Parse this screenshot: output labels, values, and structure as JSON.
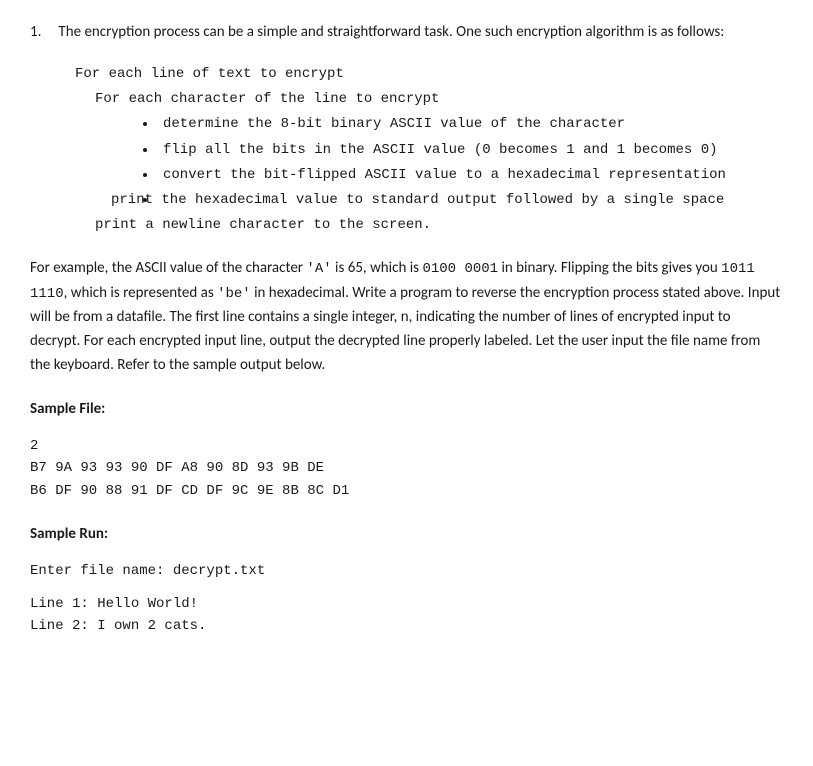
{
  "problem_number": "1.",
  "intro": "The encryption process can be a simple and straightforward task. One such encryption algorithm is as follows:",
  "algo": {
    "line1": "For each line of text to encrypt",
    "line2": "For each character of the line to encrypt",
    "bullets": [
      "determine the 8-bit binary ASCII value of the character",
      "flip all the bits in the ASCII value (0 becomes 1 and 1 becomes 0)",
      "convert the bit-flipped ASCII value to a hexadecimal representation",
      "print the hexadecimal value to standard output followed by a single space"
    ],
    "line_last": "print a newline character to the screen."
  },
  "body_p1_a": "For example, the ASCII value of the character ",
  "body_p1_code1": "'A'",
  "body_p1_b": " is 65, which is ",
  "body_p1_code2": "0100  0001",
  "body_p1_c": " in binary. Flipping the bits gives you ",
  "body_p1_code3": "1011  1110",
  "body_p1_d": ", which is represented as ",
  "body_p1_code4": "'be'",
  "body_p1_e": " in hexadecimal. Write a program to reverse the encryption process stated above. Input will be from a datafile. The first line contains a single integer, n, indicating the number of lines of encrypted input to decrypt. For each encrypted input line, output the decrypted line properly labeled.  Let the user input the file name from the keyboard.  Refer to the sample output below.",
  "sample_file_label": "Sample File:",
  "sample_file": {
    "line1": "2",
    "line2": "B7 9A 93 93 90 DF A8 90 8D 93 9B DE",
    "line3": "B6 DF 90 88 91 DF CD DF 9C 9E 8B 8C D1"
  },
  "sample_run_label": "Sample Run:",
  "sample_run": {
    "line1": "Enter file name: decrypt.txt",
    "line2": "Line 1: Hello World!",
    "line3": "Line 2: I own 2 cats."
  }
}
